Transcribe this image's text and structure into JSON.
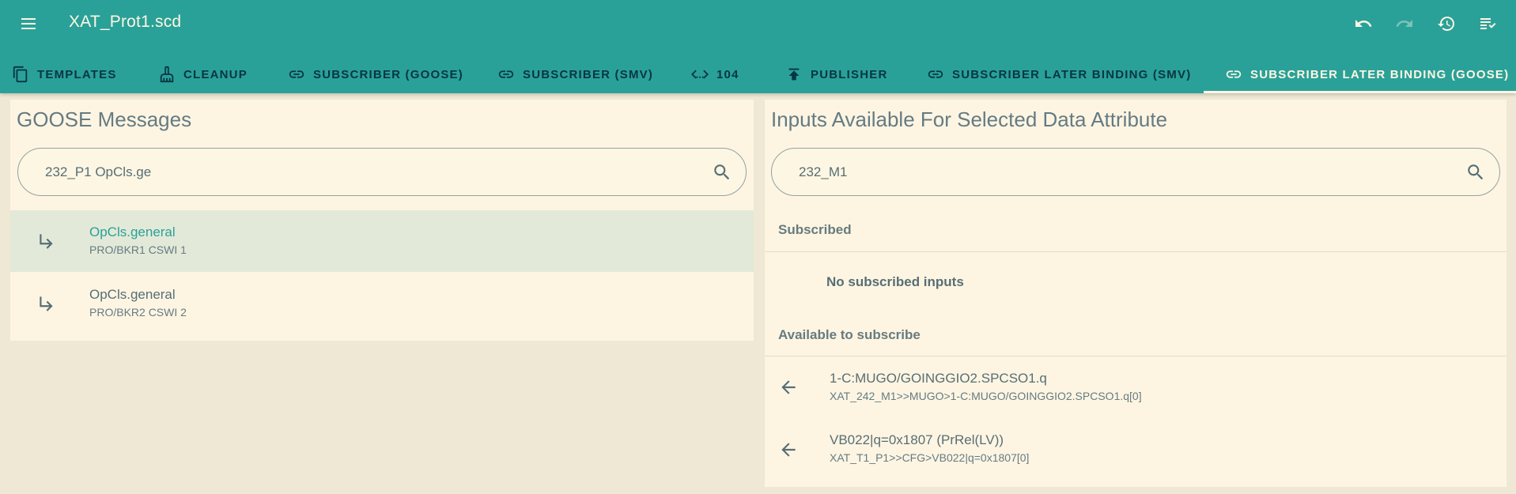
{
  "app": {
    "title": "XAT_Prot1.scd",
    "actions": [
      {
        "name": "undo-icon",
        "enabled": true
      },
      {
        "name": "redo-icon",
        "enabled": false
      },
      {
        "name": "history-icon",
        "enabled": true
      },
      {
        "name": "validate-icon",
        "enabled": true
      }
    ]
  },
  "tabs": [
    {
      "label": "TEMPLATES",
      "icon": "copy-icon"
    },
    {
      "label": "CLEANUP",
      "icon": "broom-icon"
    },
    {
      "label": "SUBSCRIBER (GOOSE)",
      "icon": "link-icon"
    },
    {
      "label": "SUBSCRIBER (SMV)",
      "icon": "link-icon"
    },
    {
      "label": "104",
      "icon": "code-icon"
    },
    {
      "label": "PUBLISHER",
      "icon": "publish-icon"
    },
    {
      "label": "SUBSCRIBER LATER BINDING (SMV)",
      "icon": "link-icon"
    },
    {
      "label": "SUBSCRIBER LATER BINDING (GOOSE)",
      "icon": "link-icon",
      "active": true
    }
  ],
  "left_panel": {
    "title": "GOOSE Messages",
    "search_value": "232_P1 OpCls.ge",
    "items": [
      {
        "primary": "OpCls.general",
        "secondary": "PRO/BKR1 CSWI 1",
        "selected": true,
        "icon": "subdirectory-arrow-right-icon"
      },
      {
        "primary": "OpCls.general",
        "secondary": "PRO/BKR2 CSWI 2",
        "selected": false,
        "icon": "subdirectory-arrow-right-icon"
      }
    ]
  },
  "right_panel": {
    "title": "Inputs Available For Selected Data Attribute",
    "search_value": "232_M1",
    "subscribed_label": "Subscribed",
    "subscribed_empty": "No subscribed inputs",
    "available_label": "Available to subscribe",
    "available": [
      {
        "primary": "1-C:MUGO/GOINGGIO2.SPCSO1.q",
        "secondary": "XAT_242_M1>>MUGO>1-C:MUGO/GOINGGIO2.SPCSO1.q[0]",
        "icon": "arrow-back-icon"
      },
      {
        "primary": "VB022|q=0x1807 (PrRel(LV))",
        "secondary": "XAT_T1_P1>>CFG>VB022|q=0x1807[0]",
        "icon": "arrow-back-icon"
      }
    ]
  },
  "colors": {
    "primary": "#2aa198",
    "on_primary": "#fdf6e3",
    "panel": "#fdf5e2",
    "background": "#eee8d5",
    "selected_row": "#e3e9d8",
    "text": "#586e75"
  }
}
